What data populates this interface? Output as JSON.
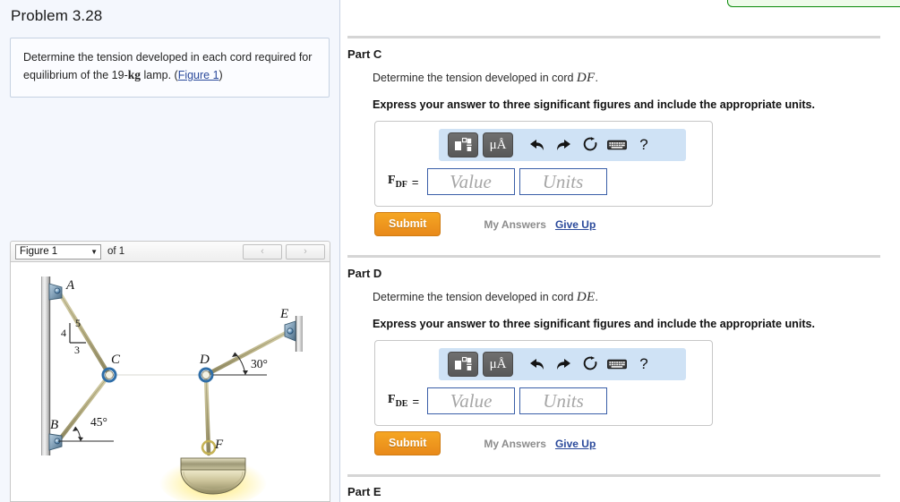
{
  "left": {
    "problem_title": "Problem 3.28",
    "statement_pre": "Determine the tension developed in each cord required for equilibrium of the 19-",
    "statement_kg": "kg",
    "statement_post": " lamp. (",
    "figure_link": "Figure 1",
    "statement_close": ")",
    "pager": {
      "selected_figure": "Figure 1",
      "caret": "▼",
      "of_text": "of 1",
      "prev_label": "‹",
      "next_label": "›"
    },
    "figure": {
      "labels": {
        "A": "A",
        "B": "B",
        "C": "C",
        "D": "D",
        "E": "E",
        "F": "F",
        "ratio_4": "4",
        "ratio_5": "5",
        "ratio_3": "3",
        "angle_45": "45°",
        "angle_30": "30°"
      }
    }
  },
  "right": {
    "parts": [
      {
        "heading": "Part C",
        "prompt_pre": "Determine the tension developed in cord ",
        "prompt_var": "DF",
        "prompt_post": ".",
        "instruction": "Express your answer to three significant figures and include the appropriate units.",
        "toolbar": {
          "template_icon": "math-template-icon",
          "units_icon": "μÅ",
          "undo_icon": "undo-icon",
          "redo_icon": "redo-icon",
          "reset_icon": "reset-icon",
          "keyboard_icon": "keyboard-icon",
          "help_icon": "?"
        },
        "var_main": "F",
        "var_sub": "DF",
        "equals": "=",
        "value_placeholder": "Value",
        "units_placeholder": "Units",
        "value_current": "",
        "units_current": "",
        "submit_label": "Submit",
        "my_answers_label": "My Answers",
        "give_up_label": "Give Up"
      },
      {
        "heading": "Part D",
        "prompt_pre": "Determine the tension developed in cord ",
        "prompt_var": "DE",
        "prompt_post": ".",
        "instruction": "Express your answer to three significant figures and include the appropriate units.",
        "toolbar": {
          "template_icon": "math-template-icon",
          "units_icon": "μÅ",
          "undo_icon": "undo-icon",
          "redo_icon": "redo-icon",
          "reset_icon": "reset-icon",
          "keyboard_icon": "keyboard-icon",
          "help_icon": "?"
        },
        "var_main": "F",
        "var_sub": "DE",
        "equals": "=",
        "value_placeholder": "Value",
        "units_placeholder": "Units",
        "value_current": "",
        "units_current": "",
        "submit_label": "Submit",
        "my_answers_label": "My Answers",
        "give_up_label": "Give Up"
      }
    ],
    "part_e_heading": "Part E"
  },
  "colors": {
    "submit_orange": "#e8891a",
    "link_blue": "#2b4a9b",
    "toolbar_blue": "#cfe2f5",
    "panel_bg": "#f4f7fd",
    "correct_green_border": "#0a8a0a",
    "correct_green_fill": "#eefbea"
  }
}
